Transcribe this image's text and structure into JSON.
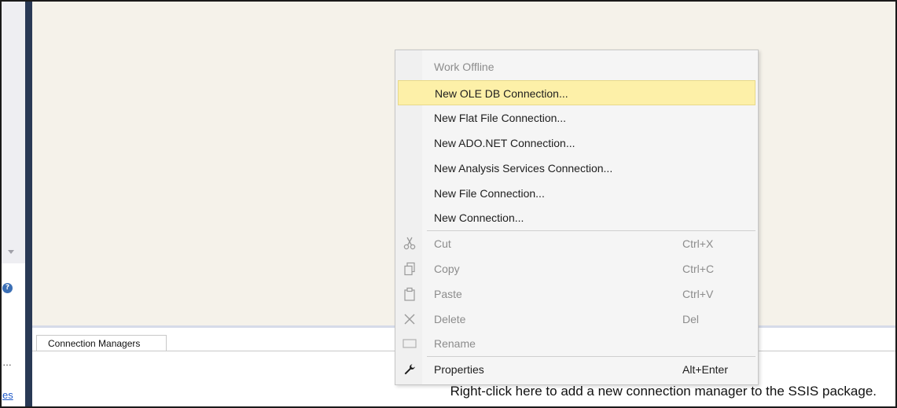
{
  "left_panel": {
    "help_glyph": "?",
    "ellipsis_text": "…",
    "link_text": "es"
  },
  "connection_managers": {
    "tab_label": "Connection Managers",
    "hint_text": "Right-click here to add a new connection manager to the SSIS package."
  },
  "context_menu": {
    "work_offline": "Work Offline",
    "new_oledb": "New OLE DB Connection...",
    "new_flat_file": "New Flat File Connection...",
    "new_adonet": "New ADO.NET Connection...",
    "new_analysis_services": "New Analysis Services Connection...",
    "new_file": "New File Connection...",
    "new_connection": "New Connection...",
    "cut": {
      "label": "Cut",
      "shortcut": "Ctrl+X",
      "icon": "scissors-icon"
    },
    "copy": {
      "label": "Copy",
      "shortcut": "Ctrl+C",
      "icon": "copy-icon"
    },
    "paste": {
      "label": "Paste",
      "shortcut": "Ctrl+V",
      "icon": "paste-icon"
    },
    "delete": {
      "label": "Delete",
      "shortcut": "Del",
      "icon": "delete-x-icon"
    },
    "rename": {
      "label": "Rename",
      "icon": "rename-icon"
    },
    "properties": {
      "label": "Properties",
      "shortcut": "Alt+Enter",
      "icon": "wrench-icon"
    }
  },
  "colors": {
    "splitter": "#293955",
    "design_surface": "#f5f2ea",
    "menu_highlight": "#fdf0a8",
    "link": "#1e58c8"
  }
}
